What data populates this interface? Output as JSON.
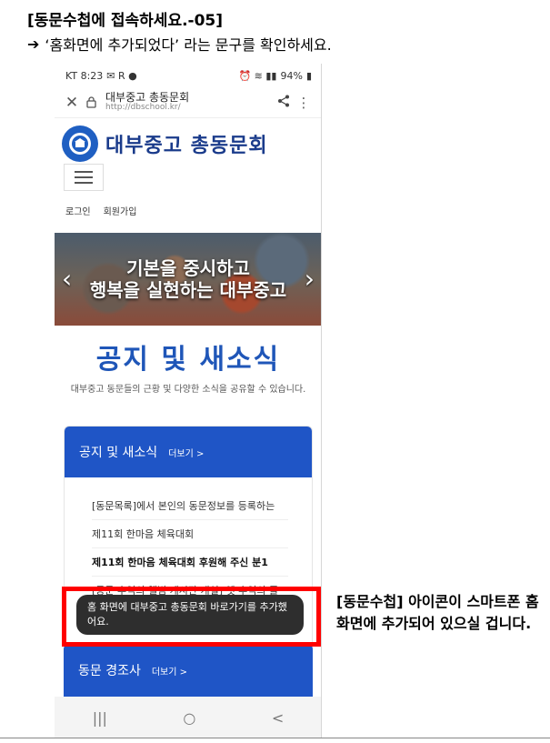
{
  "doc": {
    "title": "[동문수첩에 접속하세요.-05]",
    "instruction": "‘홈화면에 추가되었다’ 라는 문구를 확인하세요.",
    "annotation": "[동문수첩] 아이콘이 스마트폰 홈화면에 추가되어 있으실 겁니다."
  },
  "status": {
    "left": "KT 8:23",
    "battery": "94%"
  },
  "browser": {
    "site_title": "대부중고 총동문회",
    "site_url": "http://dbschool.kr/"
  },
  "site": {
    "brand_name": "대부중고 총동문회",
    "login": "로그인",
    "signup": "회원가입"
  },
  "hero": {
    "line1": "기본을 중시하고",
    "line2": "행복을 실현하는 대부중고"
  },
  "notice": {
    "heading": "공지 및 새소식",
    "description": "대부중고 동문들의 근황 및 다양한 소식을 공유할 수 있습니다."
  },
  "card": {
    "title": "공지 및 새소식",
    "more": "더보기 >",
    "items": [
      "[동문목록]에서 본인의 동문정보를 등록하는",
      "제11회 한마음 체육대회",
      "제11회 한마음 체육대회 후원해 주신 분1",
      "[동문 추억의 앨범 게시판 개설] 옛 추억의 줄"
    ]
  },
  "card2": {
    "title": "동문 경조사",
    "more": "더보기 >"
  },
  "toast": {
    "text": "홈 화면에 대부중고 총동문회 바로가기를 추가했어요."
  },
  "navbar": {
    "recent": "|||",
    "home": "○",
    "back": "<"
  },
  "colors": {
    "accent": "#1f55c6",
    "highlight": "#ff0000"
  }
}
